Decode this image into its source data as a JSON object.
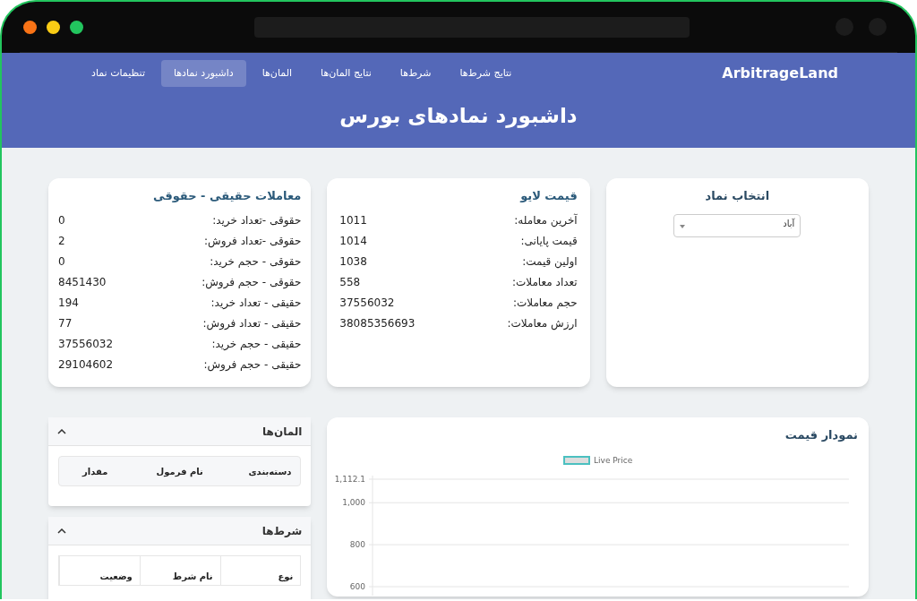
{
  "navbar": {
    "brand": "ArbitrageLand",
    "items": [
      {
        "label": "نتایج شرط‌ها",
        "selected": false
      },
      {
        "label": "شرط‌ها",
        "selected": false
      },
      {
        "label": "نتایج المان‌ها",
        "selected": false
      },
      {
        "label": "المان‌ها",
        "selected": false
      },
      {
        "label": "داشبورد نمادها",
        "selected": true
      },
      {
        "label": "تنظیمات نماد",
        "selected": false
      }
    ]
  },
  "page_title": "داشبورد نمادهای بورس",
  "symbol_select": {
    "title": "انتخاب نماد",
    "value": "آباد"
  },
  "live_price": {
    "title": "قیمت لایو",
    "rows": [
      {
        "label": "آخرین معامله:",
        "value": "1011"
      },
      {
        "label": "قیمت پایانی:",
        "value": "1014"
      },
      {
        "label": "اولین قیمت:",
        "value": "1038"
      },
      {
        "label": "تعداد معاملات:",
        "value": "558"
      },
      {
        "label": "حجم معاملات:",
        "value": "37556032"
      },
      {
        "label": "ارزش معاملات:",
        "value": "38085356693"
      }
    ]
  },
  "trades": {
    "title": "معاملات حقیقی - حقوقی",
    "rows": [
      {
        "label": "حقوقی -تعداد خرید:",
        "value": "0"
      },
      {
        "label": "حقوقی -تعداد فروش:",
        "value": "2"
      },
      {
        "label": "حقوقی - حجم خرید:",
        "value": "0"
      },
      {
        "label": "حقوقی - حجم فروش:",
        "value": "8451430"
      },
      {
        "label": "حقیقی - تعداد خرید:",
        "value": "194"
      },
      {
        "label": "حقیقی - تعداد فروش:",
        "value": "77"
      },
      {
        "label": "حقیقی - حجم خرید:",
        "value": "37556032"
      },
      {
        "label": "حقیقی - حجم فروش:",
        "value": "29104602"
      }
    ]
  },
  "price_chart": {
    "title": "نمودار قیمت",
    "chart_data": {
      "type": "line",
      "series": [
        {
          "name": "Live Price",
          "color": "#4bc0c0"
        }
      ],
      "ylim": [
        600,
        1112.1
      ],
      "yticks": [
        {
          "value": 600,
          "label": "600"
        },
        {
          "value": 800,
          "label": "800"
        },
        {
          "value": 1000,
          "label": "1,000"
        },
        {
          "value": 1112.1,
          "label": "1,112.1"
        }
      ]
    }
  },
  "panels": [
    {
      "title": "المان‌ها",
      "expanded": true,
      "columns": [
        "دسته‌بندی",
        "نام فرمول",
        "مقدار"
      ]
    },
    {
      "title": "شرط‌ها",
      "expanded": true,
      "columns": [
        "نوع",
        "نام شرط",
        "وضعیت"
      ]
    }
  ]
}
